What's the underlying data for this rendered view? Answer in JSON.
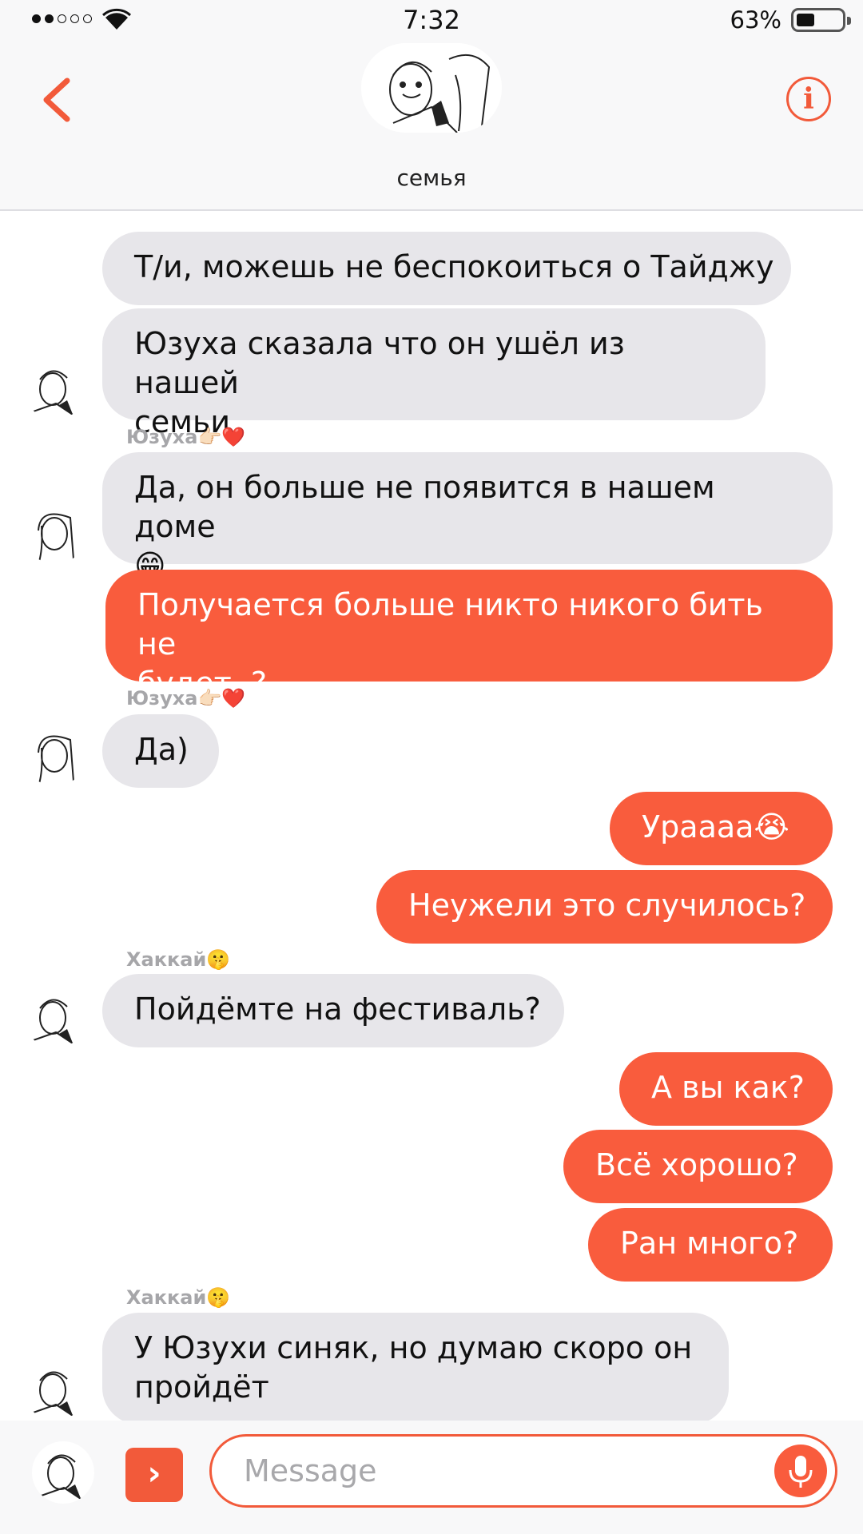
{
  "status_bar": {
    "time": "7:32",
    "battery_percent": "63%",
    "signal_bars": 2,
    "signal_total": 5
  },
  "header": {
    "chat_title": "семья",
    "back_icon": "chevron-left-icon",
    "info_icon": "info-circle-icon",
    "info_glyph": "i",
    "accent_color": "#f25a3a"
  },
  "messages": [
    {
      "type": "in",
      "text": "Т/и, можешь не беспокоиться о Тайджу"
    },
    {
      "type": "in",
      "text": "Юзуха сказала что он ушёл из нашей\nсемьи"
    },
    {
      "type": "sender",
      "text": "Юзуха👉🏻❤️"
    },
    {
      "type": "in",
      "text": "Да, он больше не появится в нашем доме\n😁"
    },
    {
      "type": "out",
      "text": "Получается больше никто никого бить не\nбудет..?"
    },
    {
      "type": "sender",
      "text": "Юзуха👉🏻❤️"
    },
    {
      "type": "in",
      "text": "Да)"
    },
    {
      "type": "out",
      "text": "Ураааа😭"
    },
    {
      "type": "out",
      "text": "Неужели это случилось?"
    },
    {
      "type": "sender",
      "text": "Хаккай🤫"
    },
    {
      "type": "in",
      "text": "Пойдёмте на фестиваль?"
    },
    {
      "type": "out",
      "text": "А вы как?"
    },
    {
      "type": "out",
      "text": "Всё хорошо?"
    },
    {
      "type": "out",
      "text": "Ран много?"
    },
    {
      "type": "sender",
      "text": "Хаккай🤫"
    },
    {
      "type": "in",
      "text": "У Юзухи синяк, но думаю скоро он\nпройдёт"
    }
  ],
  "composer": {
    "placeholder": "Message",
    "send_toggle_glyph": "›",
    "mic_icon": "microphone-icon"
  },
  "colors": {
    "outgoing_bubble": "#f95c3d",
    "incoming_bubble": "#e7e6ea",
    "header_bg": "#f8f8f9"
  }
}
